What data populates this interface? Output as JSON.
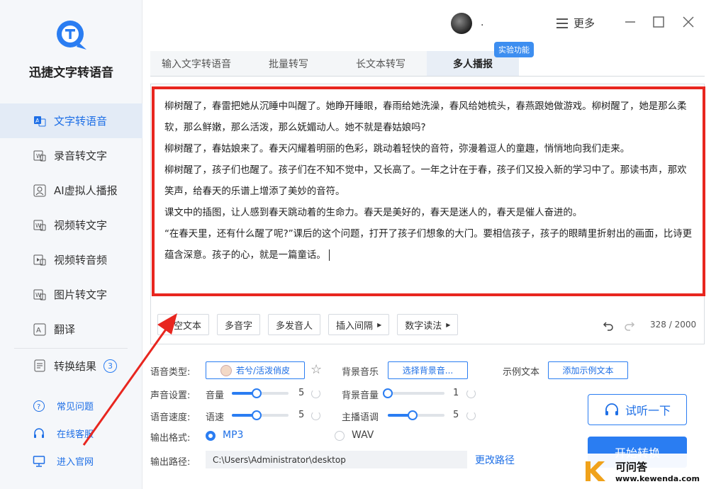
{
  "app": {
    "name": "迅捷文字转语音"
  },
  "titlebar": {
    "username": ".",
    "more_label": "更多"
  },
  "sidebar": {
    "items": [
      {
        "label": "文字转语音",
        "icon": "text-to-speech-icon",
        "active": true
      },
      {
        "label": "录音转文字",
        "icon": "recording-icon"
      },
      {
        "label": "AI虚拟人播报",
        "icon": "ai-avatar-icon"
      },
      {
        "label": "视频转文字",
        "icon": "video-text-icon"
      },
      {
        "label": "视频转音频",
        "icon": "video-audio-icon"
      },
      {
        "label": "图片转文字",
        "icon": "image-text-icon"
      },
      {
        "label": "翻译",
        "icon": "translate-icon"
      }
    ],
    "results": {
      "label": "转换结果",
      "count": "3"
    },
    "links": [
      {
        "label": "常见问题",
        "icon": "question-icon"
      },
      {
        "label": "在线客服",
        "icon": "headset-icon"
      },
      {
        "label": "进入官网",
        "icon": "monitor-icon"
      }
    ]
  },
  "tabs": [
    {
      "label": "输入文字转语音"
    },
    {
      "label": "批量转写"
    },
    {
      "label": "长文本转写"
    },
    {
      "label": "多人播报",
      "active": true
    }
  ],
  "tab_badge": "实验功能",
  "editor": {
    "paragraphs": [
      "柳树醒了，春雷把她从沉睡中叫醒了。她睁开睡眼，春雨给她洗澡，春风给她梳头，春燕跟她做游戏。柳树醒了，她是那么柔软，那么鲜嫩，那么活泼，那么妩媚动人。她不就是春姑娘吗?",
      "柳树醒了，春姑娘来了。春天闪耀着明丽的色彩，跳动着轻快的音符，弥漫着逗人的童趣，悄悄地向我们走来。",
      "柳树醒了，孩子们也醒了。孩子们在不知不觉中，又长高了。一年之计在于春，孩子们又投入新的学习中了。那读书声，那欢笑声，给春天的乐谱上增添了美妙的音符。",
      "课文中的插图，让人感到春天跳动着的生命力。春天是美好的，春天是迷人的，春天是催人奋进的。",
      "“在春天里，还有什么醒了呢?”课后的这个问题，打开了孩子们想象的大门。要相信孩子，孩子的眼睛里折射出的画面，比诗更蕴含深意。孩子的心，就是一篇童话。"
    ]
  },
  "toolbar": {
    "clear_label": "空文本",
    "polyphone_label": "多音字",
    "multi_speaker_label": "多发音人",
    "insert_pause_label": "插入间隔",
    "number_read_label": "数字读法",
    "counter": "328 / 2000"
  },
  "settings": {
    "voice_type_label": "语音类型:",
    "voice_value": "若兮/活泼俏皮",
    "bg_music_label": "背景音乐",
    "bg_music_button": "选择背景音...",
    "sample_text_label": "示例文本",
    "sample_text_button": "添加示例文本",
    "sound_settings_label": "声音设置:",
    "volume_label": "音量",
    "volume_value": "5",
    "bg_volume_label": "背景音量",
    "bg_volume_value": "1",
    "speed_section_label": "语音速度:",
    "speed_label": "语速",
    "speed_value": "5",
    "tone_label": "主播语调",
    "tone_value": "5",
    "format_label": "输出格式:",
    "format_mp3": "MP3",
    "format_wav": "WAV",
    "path_label": "输出路径:",
    "path_value": "C:\\Users\\Administrator\\desktop",
    "change_path": "更改路径"
  },
  "actions": {
    "listen_label": "试听一下",
    "convert_label": "开始转换"
  },
  "watermark": {
    "name": "可问答",
    "url": "www.kewenda.com"
  },
  "colors": {
    "accent": "#2a7df2",
    "highlight_border": "#e8261f",
    "sidebar_bg": "#f5f7fa"
  }
}
